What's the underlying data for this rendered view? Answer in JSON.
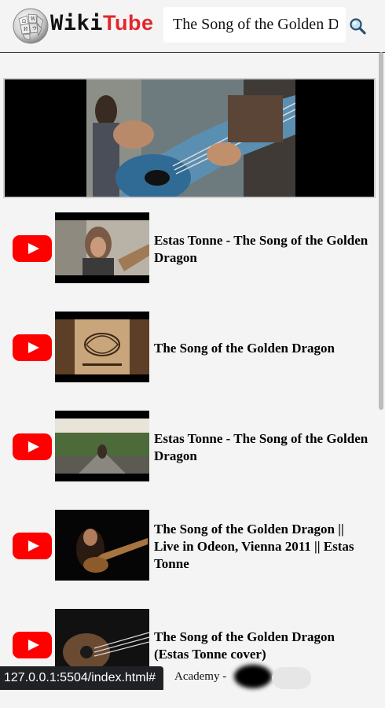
{
  "header": {
    "brand_wiki": "Wiki",
    "brand_tube": "Tube",
    "search_value": "The Song of the Golden Dragon",
    "search_icon": "magnifier-icon"
  },
  "player": {
    "label": "now-playing-video"
  },
  "results": [
    {
      "title": "Estas Tonne - The Song of the Golden Dragon"
    },
    {
      "title": "The Song of the Golden Dragon"
    },
    {
      "title": "Estas Tonne - The Song of the Golden Dragon"
    },
    {
      "title": "The Song of the Golden Dragon || Live in Odeon, Vienna 2011 || Estas Tonne"
    },
    {
      "title": "The Song of the Golden Dragon (Estas Tonne cover)"
    }
  ],
  "footer_teaser": "Academy -",
  "status_url": "127.0.0.1:5504/index.html#",
  "colors": {
    "brand_red": "#e3262b",
    "youtube_red": "#ff0000",
    "background": "#f4f4f4"
  }
}
